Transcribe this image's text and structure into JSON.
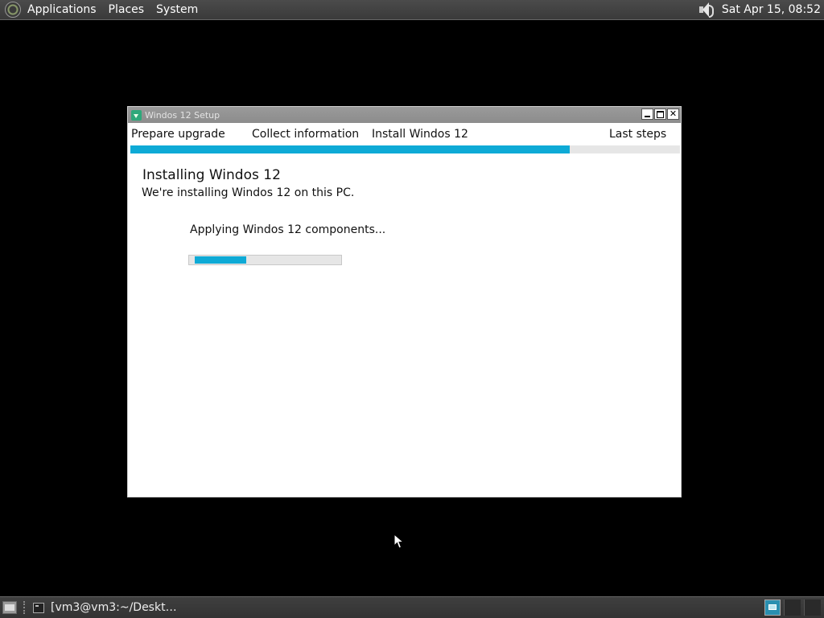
{
  "top_panel": {
    "menus": [
      "Applications",
      "Places",
      "System"
    ],
    "clock": "Sat Apr 15, 08:52",
    "icons": {
      "logo": "os-logo-icon",
      "volume": "speaker-icon"
    }
  },
  "window": {
    "title": "Windos 12 Setup",
    "steps": [
      "Prepare upgrade",
      "Collect information",
      "Install Windos 12",
      "Last steps"
    ],
    "overall_progress": 0.8,
    "heading": "Installing Windos 12",
    "subheading": "We're installing Windos 12 on this PC.",
    "component_status": "Applying Windos 12 components...",
    "component_progress": 0.35,
    "accent_color": "#0eaad6"
  },
  "taskbar": {
    "task_label": "[vm3@vm3:~/Deskt…"
  }
}
